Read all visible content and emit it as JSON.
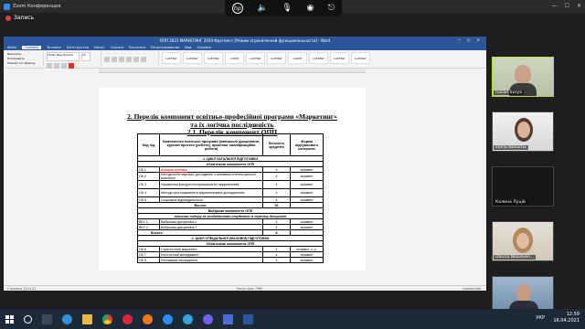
{
  "zoom": {
    "window_title": "Zoom Конференция",
    "recording_label": "Запись"
  },
  "word": {
    "title_bar": "ОПП 2021 МАРКЕТИНГ 2020 Фрагмент [Режим ограниченной функциональности] - Word",
    "tabs": [
      "Файл",
      "Главная",
      "Вставка",
      "Конструктор",
      "Макет",
      "Ссылки",
      "Рассылки",
      "Рецензирование",
      "Вид",
      "Справка"
    ],
    "active_tab": "Главная",
    "clipboard": [
      "Вырезать",
      "Копировать",
      "Формат по образцу"
    ],
    "font_name": "Times New Roman",
    "font_size": "14",
    "styles": [
      "АаБбВвГ",
      "АаБбВвГ",
      "АаБбВвГ",
      "АаБбВ",
      "АаБбВвГ",
      "АаБбВвГ",
      "АаБбВ",
      "АаБбВвГ",
      "АаБбВвГ",
      "АаБбВвГ"
    ],
    "status_left": "Страница 14 из 53",
    "status_words": "Число слов: 7960",
    "status_lang": "украинский"
  },
  "document": {
    "heading_1": "2. Перелік компонент освітньо-професійної програми «Маркетинг»",
    "heading_2": "та  їх логічна послідовність",
    "heading_3": "2.1. Перелік компонент ОПП",
    "table": {
      "headers": {
        "code": "Код н/д",
        "component": "Компоненти освітньої програми (навчальні дисципліни, курсові проекти (роботи), практики, кваліфікаційна робота)",
        "credits": "Кількість кредитів",
        "control": "Форма підсумкового контролю"
      },
      "section_1": "1. ЦИКЛ ЗАГАЛЬНОЇ ПІДГОТОВКИ",
      "mandatory_1": "Обов'язкові компоненти ОПП",
      "rows_1": [
        {
          "code": "ОК 1.",
          "name": "Аграрна політика",
          "credits": "4",
          "control": "екзамен"
        },
        {
          "code": "ОК 2.",
          "name": "Методологія наукових досліджень з основами інтелектуальної власності",
          "credits": "4",
          "control": "екзамен"
        },
        {
          "code": "ОК 3.",
          "name": "Управління конкурентоспроможністю підприємства",
          "credits": "4",
          "control": "екзамен"
        },
        {
          "code": "ОК 4.",
          "name": "Методи прогнозування в маркетинговіна дослідженнях",
          "credits": "4",
          "control": "екзамен"
        },
        {
          "code": "ОК 5.",
          "name": "Соціальна відповідальність",
          "credits": "4",
          "control": "екзамен"
        }
      ],
      "total_1": {
        "label": "Всього",
        "value": "20"
      },
      "elective_title": "Вибіркові компоненти ОПП",
      "elective_sub": "вільного вибору за уподобаннями студентів із переліку дисциплін",
      "rows_2": [
        {
          "code": "ВКУ 1",
          "name": "Вибіркова дисципліна 1",
          "credits": "4",
          "control": "екзамен"
        },
        {
          "code": "ВКУ 2",
          "name": "Вибіркова дисципліна 2",
          "credits": "4",
          "control": "екзамен"
        }
      ],
      "total_2": {
        "label": "Всього",
        "value": "8"
      },
      "section_2": "2. ЦИКЛ СПЕЦІАЛЬНОЇ (ФАХОВОЇ) ПІДГОТОВКИ",
      "mandatory_2": "Обов'язкові компоненти ОПП",
      "rows_3": [
        {
          "code": "ОК 6.",
          "name": "Стратегічний маркетинг",
          "credits": "4",
          "control": "екзамен, к. р."
        },
        {
          "code": "ОК 7.",
          "name": "Логістичний менеджмент",
          "credits": "4",
          "control": "екзамен"
        },
        {
          "code": "ОК 8.",
          "name": "Рекламний менеджмент",
          "credits": "4",
          "control": "екзамен"
        }
      ]
    }
  },
  "participants": [
    {
      "name": "ruslan burya",
      "active": true
    },
    {
      "name": "Elena Nahorna",
      "active": false
    },
    {
      "name": "Калина Луцій",
      "active": false
    },
    {
      "name": "Darina Nikolaien...",
      "active": false
    },
    {
      "name": "Олександр Луцій",
      "active": false
    }
  ],
  "taskbar": {
    "time": "12:59",
    "date": "16.04.2021",
    "lang": "УКР"
  },
  "colors": {
    "word_blue": "#2b579a",
    "active_speaker": "#b6d84a",
    "taskbar": "#1c2a38"
  }
}
